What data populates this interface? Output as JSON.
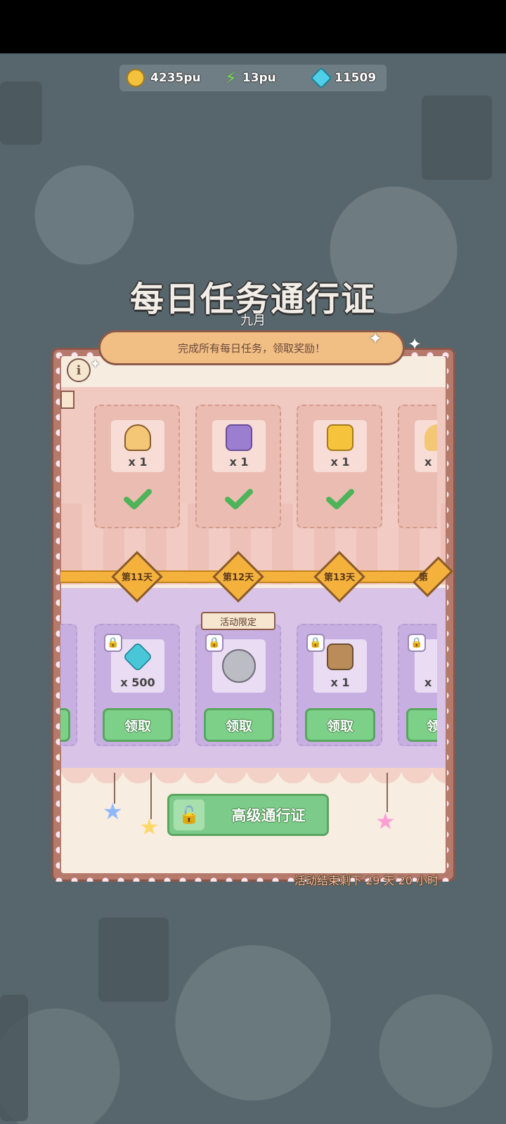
{
  "resources": {
    "coins": "4235pu",
    "energy": "13pu",
    "gems": "11509"
  },
  "title": "每日任务通行证",
  "month": "九月",
  "banner_text": "完成所有每日任务，领取奖励！",
  "free_rewards": [
    {
      "qty": "x 1",
      "icon": "pudding-icon"
    },
    {
      "qty": "x 1",
      "icon": "moon-ticket-icon"
    },
    {
      "qty": "x 1",
      "icon": "golden-ticket-icon"
    },
    {
      "qty": "x",
      "icon": "pudding-icon"
    }
  ],
  "days": [
    "第11天",
    "第12天",
    "第13天",
    "第"
  ],
  "limited_tag": "活动限定",
  "premium_rewards": [
    {
      "qty": "x 500",
      "claim": "领取",
      "icon": "gem-icon"
    },
    {
      "qty": "",
      "claim": "领取",
      "icon": "elephant-plush-icon"
    },
    {
      "qty": "x 1",
      "claim": "领取",
      "icon": "moon-ticket-icon"
    },
    {
      "qty": "x",
      "claim": "领",
      "icon": "gem-icon"
    }
  ],
  "premium_pass_label": "高级通行证",
  "countdown": "活动结束剩下 29 天 20 小时",
  "colors": {
    "gold": "#f4b23d",
    "green": "#7dcb8a",
    "pink": "#f0c9c0",
    "purple": "#d9c3e6"
  }
}
